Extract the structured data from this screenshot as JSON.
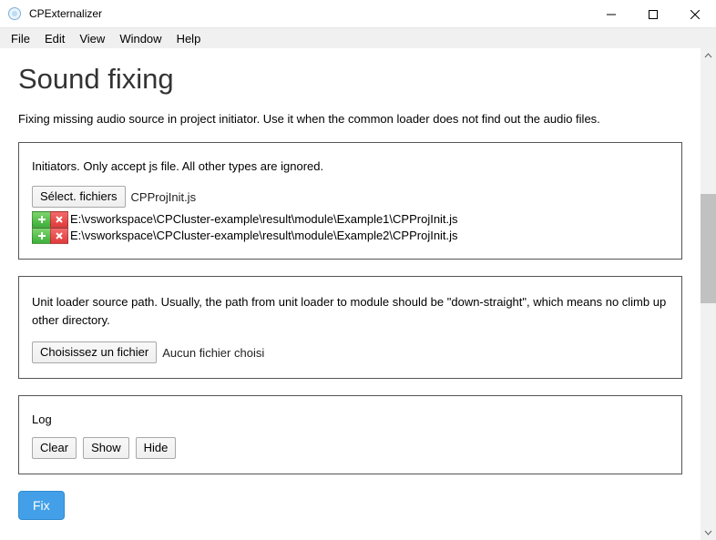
{
  "window": {
    "title": "CPExternalizer"
  },
  "menu": {
    "file": "File",
    "edit": "Edit",
    "view": "View",
    "window": "Window",
    "help": "Help"
  },
  "page": {
    "heading": "Sound fixing",
    "subtitle": "Fixing missing audio source in project initiator. Use it when the common loader does not find out the audio files."
  },
  "initiators": {
    "label": "Initiators. Only accept js file. All other types are ignored.",
    "choose_button": "Sélect. fichiers",
    "chosen_file": "CPProjInit.js",
    "paths": [
      "E:\\vsworkspace\\CPCluster-example\\result\\module\\Example1\\CPProjInit.js",
      "E:\\vsworkspace\\CPCluster-example\\result\\module\\Example2\\CPProjInit.js"
    ]
  },
  "unitloader": {
    "label": "Unit loader source path. Usually, the path from unit loader to module should be \"down-straight\", which means no climb up other directory.",
    "choose_button": "Choisissez un fichier",
    "chosen_file": "Aucun fichier choisi"
  },
  "log": {
    "label": "Log",
    "clear": "Clear",
    "show": "Show",
    "hide": "Hide"
  },
  "actions": {
    "fix": "Fix"
  }
}
